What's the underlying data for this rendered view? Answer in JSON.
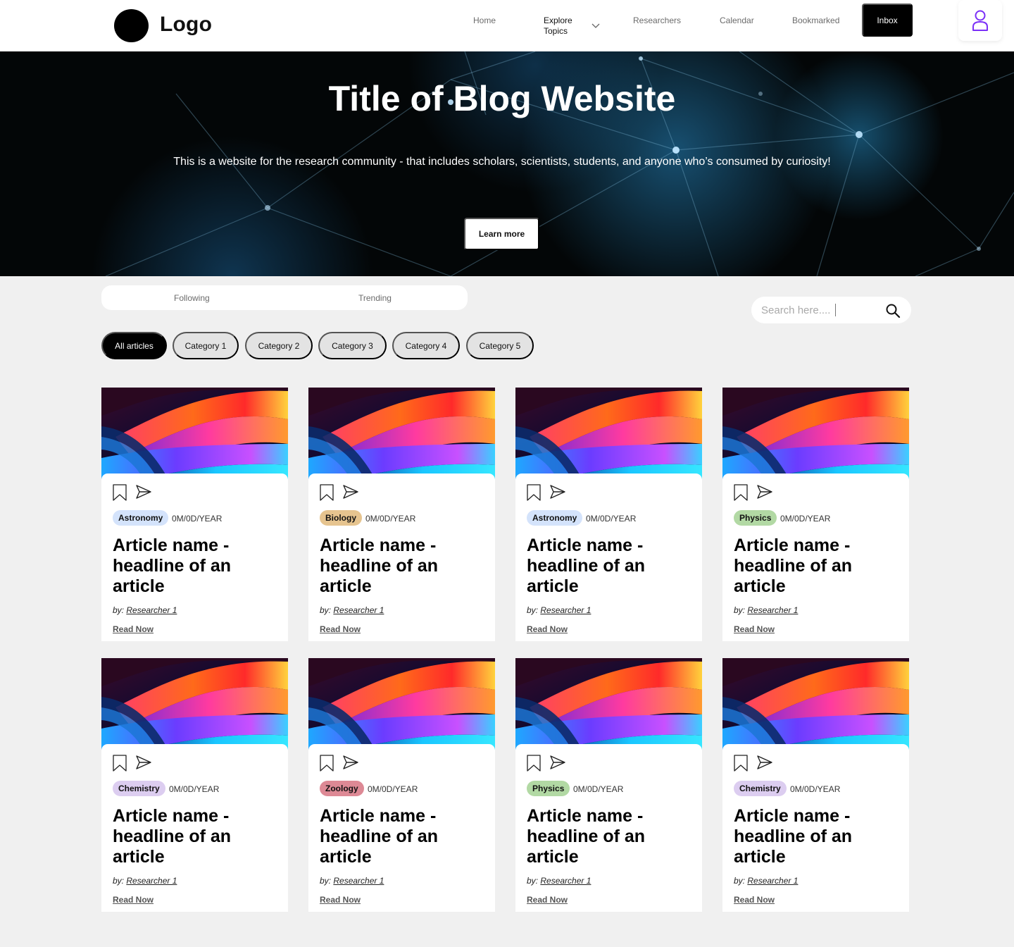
{
  "header": {
    "logo_text": "Logo",
    "nav": {
      "home": "Home",
      "explore_line1": "Explore",
      "explore_line2": "Topics",
      "researchers": "Researchers",
      "calendar": "Calendar",
      "bookmarked": "Bookmarked",
      "inbox": "Inbox"
    },
    "accent_color": "#7b2ff7"
  },
  "hero": {
    "title": "Title of Blog Website",
    "subtitle": "This is a website for the research community - that includes scholars, scientists, students, and anyone who’s consumed by curiosity!",
    "cta_label": "Learn more"
  },
  "feed_tabs": [
    "Following",
    "Trending"
  ],
  "search": {
    "placeholder": "Search here....",
    "icon": "search-icon"
  },
  "categories": [
    "All articles",
    "Category 1",
    "Category 2",
    "Category 3",
    "Category 4",
    "Category 5"
  ],
  "active_category": "All articles",
  "tag_colors": {
    "Astronomy": "#d4e3fb",
    "Biology": "#e6c48f",
    "Physics": "#b2d9a4",
    "Chemistry": "#dccdf0",
    "Zoology": "#dd8995"
  },
  "articles": [
    {
      "tag": "Astronomy",
      "date": "0M/0D/YEAR",
      "headline": "Article name - headline of an article",
      "by": "by:",
      "author": "Researcher 1",
      "link": "Read Now"
    },
    {
      "tag": "Biology",
      "date": "0M/0D/YEAR",
      "headline": "Article name - headline of an article",
      "by": "by:",
      "author": "Researcher 1",
      "link": "Read Now"
    },
    {
      "tag": "Astronomy",
      "date": "0M/0D/YEAR",
      "headline": "Article name - headline of an article",
      "by": "by:",
      "author": "Researcher 1",
      "link": "Read Now"
    },
    {
      "tag": "Physics",
      "date": "0M/0D/YEAR",
      "headline": "Article name - headline of an article",
      "by": "by:",
      "author": "Researcher 1",
      "link": "Read Now"
    },
    {
      "tag": "Chemistry",
      "date": "0M/0D/YEAR",
      "headline": "Article name - headline of an article",
      "by": "by:",
      "author": "Researcher 1",
      "link": "Read Now"
    },
    {
      "tag": "Zoology",
      "date": "0M/0D/YEAR",
      "headline": "Article name - headline of an article",
      "by": "by:",
      "author": "Researcher 1",
      "link": "Read Now"
    },
    {
      "tag": "Physics",
      "date": "0M/0D/YEAR",
      "headline": "Article name - headline of an article",
      "by": "by:",
      "author": "Researcher 1",
      "link": "Read Now"
    },
    {
      "tag": "Chemistry",
      "date": "0M/0D/YEAR",
      "headline": "Article name - headline of an article",
      "by": "by:",
      "author": "Researcher 1",
      "link": "Read Now"
    }
  ]
}
